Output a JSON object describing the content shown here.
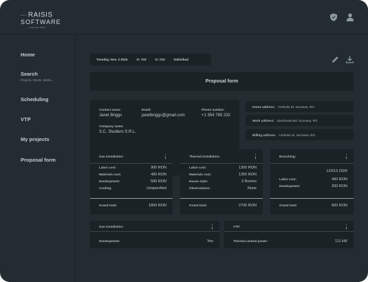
{
  "brand": {
    "small": "Ionic",
    "line1": "RAISIS",
    "line2": "SOFTWARE",
    "tagline": "+ CSO RO 2016"
  },
  "header_icons": [
    "shield-icon",
    "user-icon"
  ],
  "nav": [
    {
      "label": "Home"
    },
    {
      "label": "Search",
      "sub": "Projects, Clients, Works..."
    },
    {
      "label": "Scheduling"
    },
    {
      "label": "VTP"
    },
    {
      "label": "My projects"
    },
    {
      "label": "Proposal form"
    }
  ],
  "chips": [
    "Tuesday, Nov. 3 2015",
    "O: #33",
    "O: #34",
    "Individual"
  ],
  "tools": [
    "pencil-icon",
    "download-icon"
  ],
  "proposal": {
    "title": "Proposal form"
  },
  "contact": {
    "name_label": "Contact name:",
    "name": "Janet Briggs",
    "email_label": "Email:",
    "email": "janetbriggs@gmail.com",
    "phone_label": "Phone number:",
    "phone": "+1 354 765 232",
    "company_label": "Company name:",
    "company": "S.C. Studiero S.R.L."
  },
  "addresses": [
    {
      "label": "Home address:",
      "value": "Cerbului St. Suceava, RO"
    },
    {
      "label": "Work address:",
      "value": "Dambovita Bd. Suceava, RO"
    },
    {
      "label": "Billing address:",
      "value": "Cerbului St. Suceava, RO"
    }
  ],
  "gas": {
    "title": "Gas installation:",
    "rows": [
      {
        "k": "Labor cost:",
        "v": "900 RON"
      },
      {
        "k": "Materials cost:",
        "v": "400 RON"
      },
      {
        "k": "Development:",
        "v": "500 RON"
      },
      {
        "k": "Cooling:",
        "v": "Unspecified"
      }
    ],
    "total_label": "Grand total:",
    "total": "1800 RON"
  },
  "thermal": {
    "title": "Thermal installation:",
    "rows": [
      {
        "k": "Labor cost:",
        "v": "1350 RON"
      },
      {
        "k": "Materials cost:",
        "v": "1350 RON"
      },
      {
        "k": "House style:",
        "v": "3 Rooms"
      },
      {
        "k": "Observations:",
        "v": "None"
      }
    ],
    "total_label": "Grand total:",
    "total": "2700 RON"
  },
  "branching": {
    "title": "Branching:",
    "date": "123/13 2020",
    "rows": [
      {
        "k": "Labor cost:",
        "v": "400 RON"
      },
      {
        "k": "Development:",
        "v": "200 RON"
      }
    ],
    "total_label": "Grand total:",
    "total": "600 RON"
  },
  "gas2": {
    "title": "Gas installation:",
    "k": "Development:",
    "v": "Yes"
  },
  "vtp": {
    "title": "VTP:",
    "k": "Thermal central power:",
    "v": "111 kW"
  }
}
